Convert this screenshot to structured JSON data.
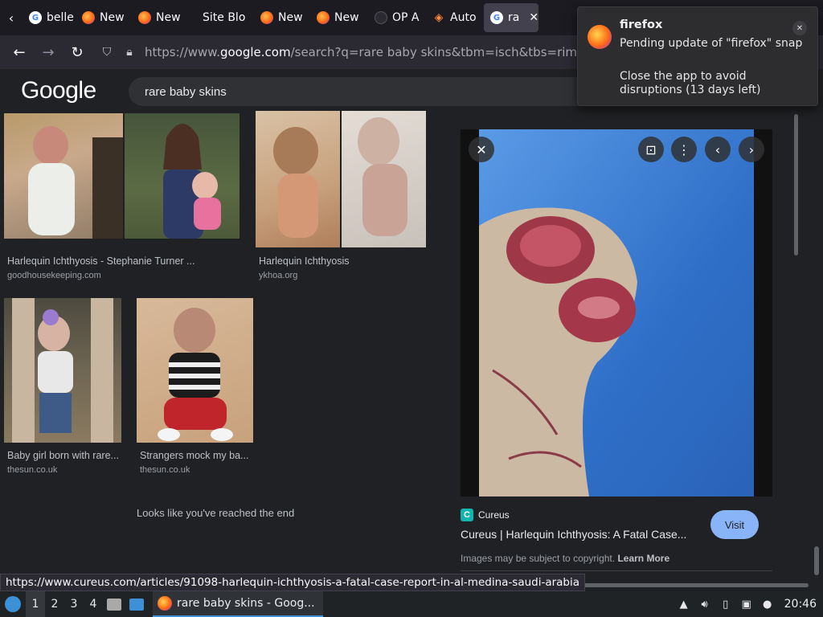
{
  "browser": {
    "tabs": [
      {
        "label": "belle",
        "icon": "google-icon",
        "active": false
      },
      {
        "label": "New",
        "icon": "firefox-icon",
        "active": false
      },
      {
        "label": "New",
        "icon": "firefox-icon",
        "active": false
      },
      {
        "label": "Site Blo",
        "icon": "none",
        "active": false
      },
      {
        "label": "New",
        "icon": "firefox-icon",
        "active": false
      },
      {
        "label": "New",
        "icon": "firefox-icon",
        "active": false
      },
      {
        "label": "OP A",
        "icon": "page-icon",
        "active": false
      },
      {
        "label": "Auto",
        "icon": "automation-icon",
        "active": false
      },
      {
        "label": "ra",
        "icon": "google-icon",
        "active": true
      }
    ],
    "url_domain_prefix": "https://www.",
    "url_domain": "google.com",
    "url_path": "/search?q=rare baby skins&tbm=isch&tbs=rimg:CR",
    "status_url": "https://www.cureus.com/articles/91098-harlequin-ichthyosis-a-fatal-case-report-in-al-medina-saudi-arabia"
  },
  "google": {
    "logo": "Google",
    "query": "rare baby skins",
    "results": [
      {
        "title": "Harlequin Ichthyosis - Stephanie Turner ...",
        "source": "goodhousekeeping.com"
      },
      {
        "title": "Harlequin Ichthyosis",
        "source": "ykhoa.org"
      },
      {
        "title": "Baby girl born with rare...",
        "source": "thesun.co.uk"
      },
      {
        "title": "Strangers mock my ba...",
        "source": "thesun.co.uk"
      }
    ],
    "end_message": "Looks like you've reached the end"
  },
  "preview": {
    "source_name": "Cureus",
    "source_icon_letter": "C",
    "title": "Cureus | Harlequin Ichthyosis: A Fatal Case...",
    "visit_label": "Visit",
    "copyright_text": "Images may be subject to copyright.",
    "learn_more": "Learn More"
  },
  "notification": {
    "app": "firefox",
    "line1": "Pending update of \"firefox\" snap",
    "line2": "Close the app to avoid disruptions (13 days left)"
  },
  "taskbar": {
    "workspaces": [
      "1",
      "2",
      "3",
      "4"
    ],
    "active_workspace": "1",
    "task_label": "rare baby skins - Goog...",
    "clock": "20:46"
  }
}
